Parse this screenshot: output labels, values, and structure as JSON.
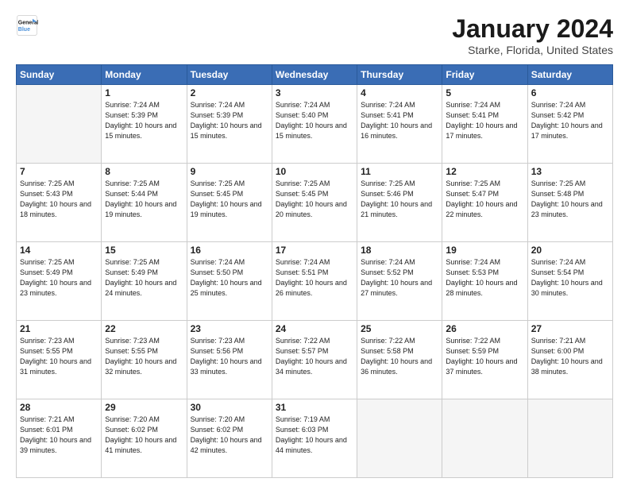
{
  "logo": {
    "line1": "General",
    "line2": "Blue"
  },
  "title": "January 2024",
  "subtitle": "Starke, Florida, United States",
  "days_of_week": [
    "Sunday",
    "Monday",
    "Tuesday",
    "Wednesday",
    "Thursday",
    "Friday",
    "Saturday"
  ],
  "weeks": [
    [
      {
        "day": null
      },
      {
        "day": "1",
        "sunrise": "7:24 AM",
        "sunset": "5:39 PM",
        "daylight": "10 hours and 15 minutes."
      },
      {
        "day": "2",
        "sunrise": "7:24 AM",
        "sunset": "5:39 PM",
        "daylight": "10 hours and 15 minutes."
      },
      {
        "day": "3",
        "sunrise": "7:24 AM",
        "sunset": "5:40 PM",
        "daylight": "10 hours and 15 minutes."
      },
      {
        "day": "4",
        "sunrise": "7:24 AM",
        "sunset": "5:41 PM",
        "daylight": "10 hours and 16 minutes."
      },
      {
        "day": "5",
        "sunrise": "7:24 AM",
        "sunset": "5:41 PM",
        "daylight": "10 hours and 17 minutes."
      },
      {
        "day": "6",
        "sunrise": "7:24 AM",
        "sunset": "5:42 PM",
        "daylight": "10 hours and 17 minutes."
      }
    ],
    [
      {
        "day": "7",
        "sunrise": "7:25 AM",
        "sunset": "5:43 PM",
        "daylight": "10 hours and 18 minutes."
      },
      {
        "day": "8",
        "sunrise": "7:25 AM",
        "sunset": "5:44 PM",
        "daylight": "10 hours and 19 minutes."
      },
      {
        "day": "9",
        "sunrise": "7:25 AM",
        "sunset": "5:45 PM",
        "daylight": "10 hours and 19 minutes."
      },
      {
        "day": "10",
        "sunrise": "7:25 AM",
        "sunset": "5:45 PM",
        "daylight": "10 hours and 20 minutes."
      },
      {
        "day": "11",
        "sunrise": "7:25 AM",
        "sunset": "5:46 PM",
        "daylight": "10 hours and 21 minutes."
      },
      {
        "day": "12",
        "sunrise": "7:25 AM",
        "sunset": "5:47 PM",
        "daylight": "10 hours and 22 minutes."
      },
      {
        "day": "13",
        "sunrise": "7:25 AM",
        "sunset": "5:48 PM",
        "daylight": "10 hours and 23 minutes."
      }
    ],
    [
      {
        "day": "14",
        "sunrise": "7:25 AM",
        "sunset": "5:49 PM",
        "daylight": "10 hours and 23 minutes."
      },
      {
        "day": "15",
        "sunrise": "7:25 AM",
        "sunset": "5:49 PM",
        "daylight": "10 hours and 24 minutes."
      },
      {
        "day": "16",
        "sunrise": "7:24 AM",
        "sunset": "5:50 PM",
        "daylight": "10 hours and 25 minutes."
      },
      {
        "day": "17",
        "sunrise": "7:24 AM",
        "sunset": "5:51 PM",
        "daylight": "10 hours and 26 minutes."
      },
      {
        "day": "18",
        "sunrise": "7:24 AM",
        "sunset": "5:52 PM",
        "daylight": "10 hours and 27 minutes."
      },
      {
        "day": "19",
        "sunrise": "7:24 AM",
        "sunset": "5:53 PM",
        "daylight": "10 hours and 28 minutes."
      },
      {
        "day": "20",
        "sunrise": "7:24 AM",
        "sunset": "5:54 PM",
        "daylight": "10 hours and 30 minutes."
      }
    ],
    [
      {
        "day": "21",
        "sunrise": "7:23 AM",
        "sunset": "5:55 PM",
        "daylight": "10 hours and 31 minutes."
      },
      {
        "day": "22",
        "sunrise": "7:23 AM",
        "sunset": "5:55 PM",
        "daylight": "10 hours and 32 minutes."
      },
      {
        "day": "23",
        "sunrise": "7:23 AM",
        "sunset": "5:56 PM",
        "daylight": "10 hours and 33 minutes."
      },
      {
        "day": "24",
        "sunrise": "7:22 AM",
        "sunset": "5:57 PM",
        "daylight": "10 hours and 34 minutes."
      },
      {
        "day": "25",
        "sunrise": "7:22 AM",
        "sunset": "5:58 PM",
        "daylight": "10 hours and 36 minutes."
      },
      {
        "day": "26",
        "sunrise": "7:22 AM",
        "sunset": "5:59 PM",
        "daylight": "10 hours and 37 minutes."
      },
      {
        "day": "27",
        "sunrise": "7:21 AM",
        "sunset": "6:00 PM",
        "daylight": "10 hours and 38 minutes."
      }
    ],
    [
      {
        "day": "28",
        "sunrise": "7:21 AM",
        "sunset": "6:01 PM",
        "daylight": "10 hours and 39 minutes."
      },
      {
        "day": "29",
        "sunrise": "7:20 AM",
        "sunset": "6:02 PM",
        "daylight": "10 hours and 41 minutes."
      },
      {
        "day": "30",
        "sunrise": "7:20 AM",
        "sunset": "6:02 PM",
        "daylight": "10 hours and 42 minutes."
      },
      {
        "day": "31",
        "sunrise": "7:19 AM",
        "sunset": "6:03 PM",
        "daylight": "10 hours and 44 minutes."
      },
      {
        "day": null
      },
      {
        "day": null
      },
      {
        "day": null
      }
    ]
  ],
  "labels": {
    "sunrise": "Sunrise:",
    "sunset": "Sunset:",
    "daylight": "Daylight:"
  }
}
